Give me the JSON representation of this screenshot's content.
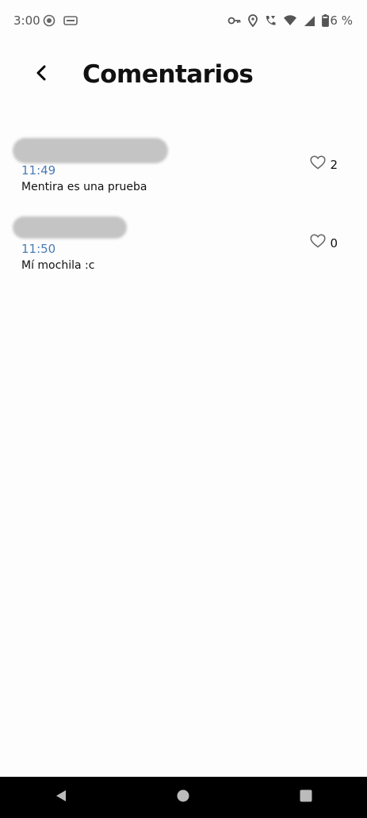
{
  "status_bar": {
    "time": "3:00",
    "battery_text": "76 %",
    "left_icons": [
      "record-icon",
      "card-icon"
    ],
    "right_icons": [
      "vpn-key-icon",
      "location-icon",
      "wifi-calling-icon",
      "wifi-icon",
      "cellular-signal-icon",
      "battery-icon"
    ]
  },
  "header": {
    "title": "Comentarios",
    "back_icon": "chevron-left-icon"
  },
  "comments": [
    {
      "time": "11:49",
      "text": "Mentira es una prueba",
      "likes": "2"
    },
    {
      "time": "11:50",
      "text": "Mí mochila :c",
      "likes": "0"
    }
  ],
  "nav_bar": {
    "icons": [
      "back-triangle-icon",
      "home-circle-icon",
      "recents-square-icon"
    ]
  },
  "colors": {
    "time_blue": "#4a7bb5",
    "redaction_gray": "#c4c4c4",
    "nav_background": "#000000"
  }
}
